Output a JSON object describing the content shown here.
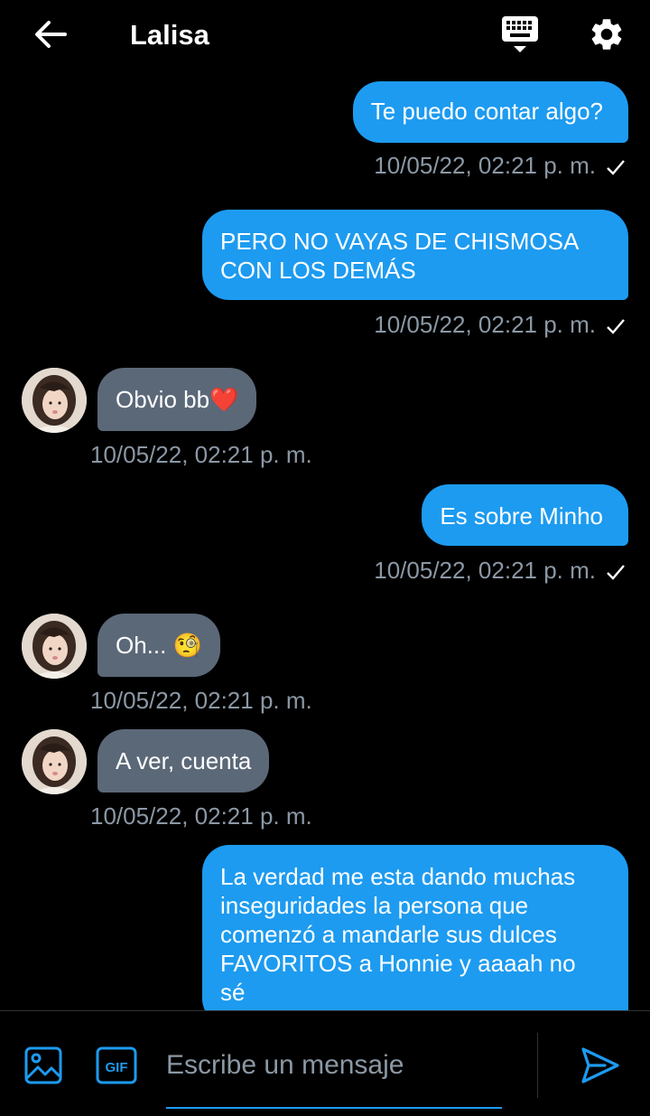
{
  "header": {
    "title": "Lalisa",
    "icons": {
      "back": "arrow-left-icon",
      "keyboard": "keyboard-icon",
      "settings": "gear-icon"
    }
  },
  "messages": [
    {
      "direction": "out",
      "text": "Te puedo contar algo?",
      "time": "10/05/22, 02:21 p. m.",
      "status": "sent"
    },
    {
      "direction": "out",
      "text": "PERO NO VAYAS DE CHISMOSA CON LOS DEMÁS",
      "time": "10/05/22, 02:21 p. m.",
      "status": "sent"
    },
    {
      "direction": "in",
      "text": "Obvio bb❤️",
      "time": "10/05/22, 02:21 p. m."
    },
    {
      "direction": "out",
      "text": "Es sobre Minho",
      "time": "10/05/22, 02:21 p. m.",
      "status": "sent"
    },
    {
      "direction": "in",
      "text": "Oh... 🧐",
      "time": "10/05/22, 02:21 p. m."
    },
    {
      "direction": "in",
      "text": "A ver, cuenta",
      "time": "10/05/22, 02:21 p. m."
    },
    {
      "direction": "out",
      "text": "La verdad me esta dando muchas inseguridades la persona que comenzó a mandarle sus dulces FAVORITOS a Honnie  y aaaah no sé",
      "time": "",
      "status": ""
    }
  ],
  "composer": {
    "placeholder": "Escribe un mensaje",
    "value": "",
    "gif_label": "GIF"
  },
  "colors": {
    "accent": "#1d9bf0",
    "incoming_bubble": "#5b6878",
    "meta_text": "#8b98a5",
    "background": "#000000"
  }
}
